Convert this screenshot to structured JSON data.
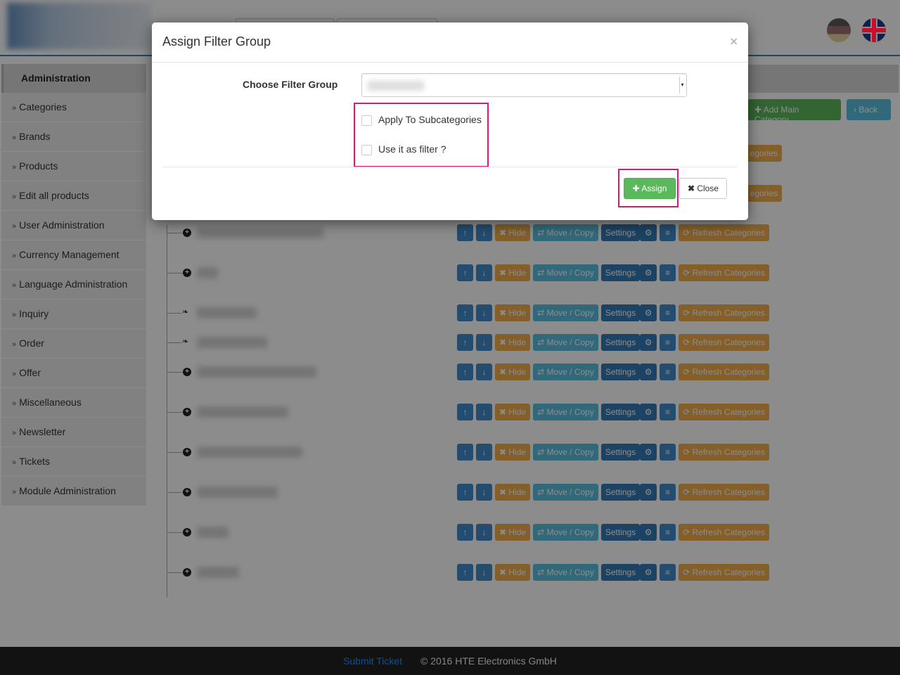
{
  "sidebar": {
    "header": "Administration",
    "items": [
      {
        "label": "Categories"
      },
      {
        "label": "Brands"
      },
      {
        "label": "Products"
      },
      {
        "label": "Edit all products"
      },
      {
        "label": "User Administration"
      },
      {
        "label": "Currency Management"
      },
      {
        "label": "Language Administration"
      },
      {
        "label": "Inquiry"
      },
      {
        "label": "Order"
      },
      {
        "label": "Offer"
      },
      {
        "label": "Miscellaneous"
      },
      {
        "label": "Newsletter"
      },
      {
        "label": "Tickets"
      },
      {
        "label": "Module Administration"
      }
    ]
  },
  "toolbar": {
    "add_main_category": "Add Main Category",
    "back": "Back"
  },
  "row_actions": {
    "hide": "Hide",
    "move_copy": "Move / Copy",
    "settings": "Settings",
    "refresh": "Refresh Categories",
    "peek_text": "egories"
  },
  "modal": {
    "title": "Assign Filter Group",
    "close_x": "×",
    "choose_label": "Choose Filter Group",
    "apply_subcategories": "Apply To Subcategories",
    "use_as_filter": "Use it as filter ?",
    "assign": "Assign",
    "close": "Close"
  },
  "footer": {
    "submit_ticket": "Submit Ticket",
    "copyright": "© 2016 HTE Electronics GmbH"
  },
  "colors": {
    "primary": "#428bca",
    "success": "#5cb85c",
    "warning": "#f0ad4e",
    "info": "#5bc0de",
    "highlight": "#e0177a",
    "footer_bg": "#222222"
  }
}
